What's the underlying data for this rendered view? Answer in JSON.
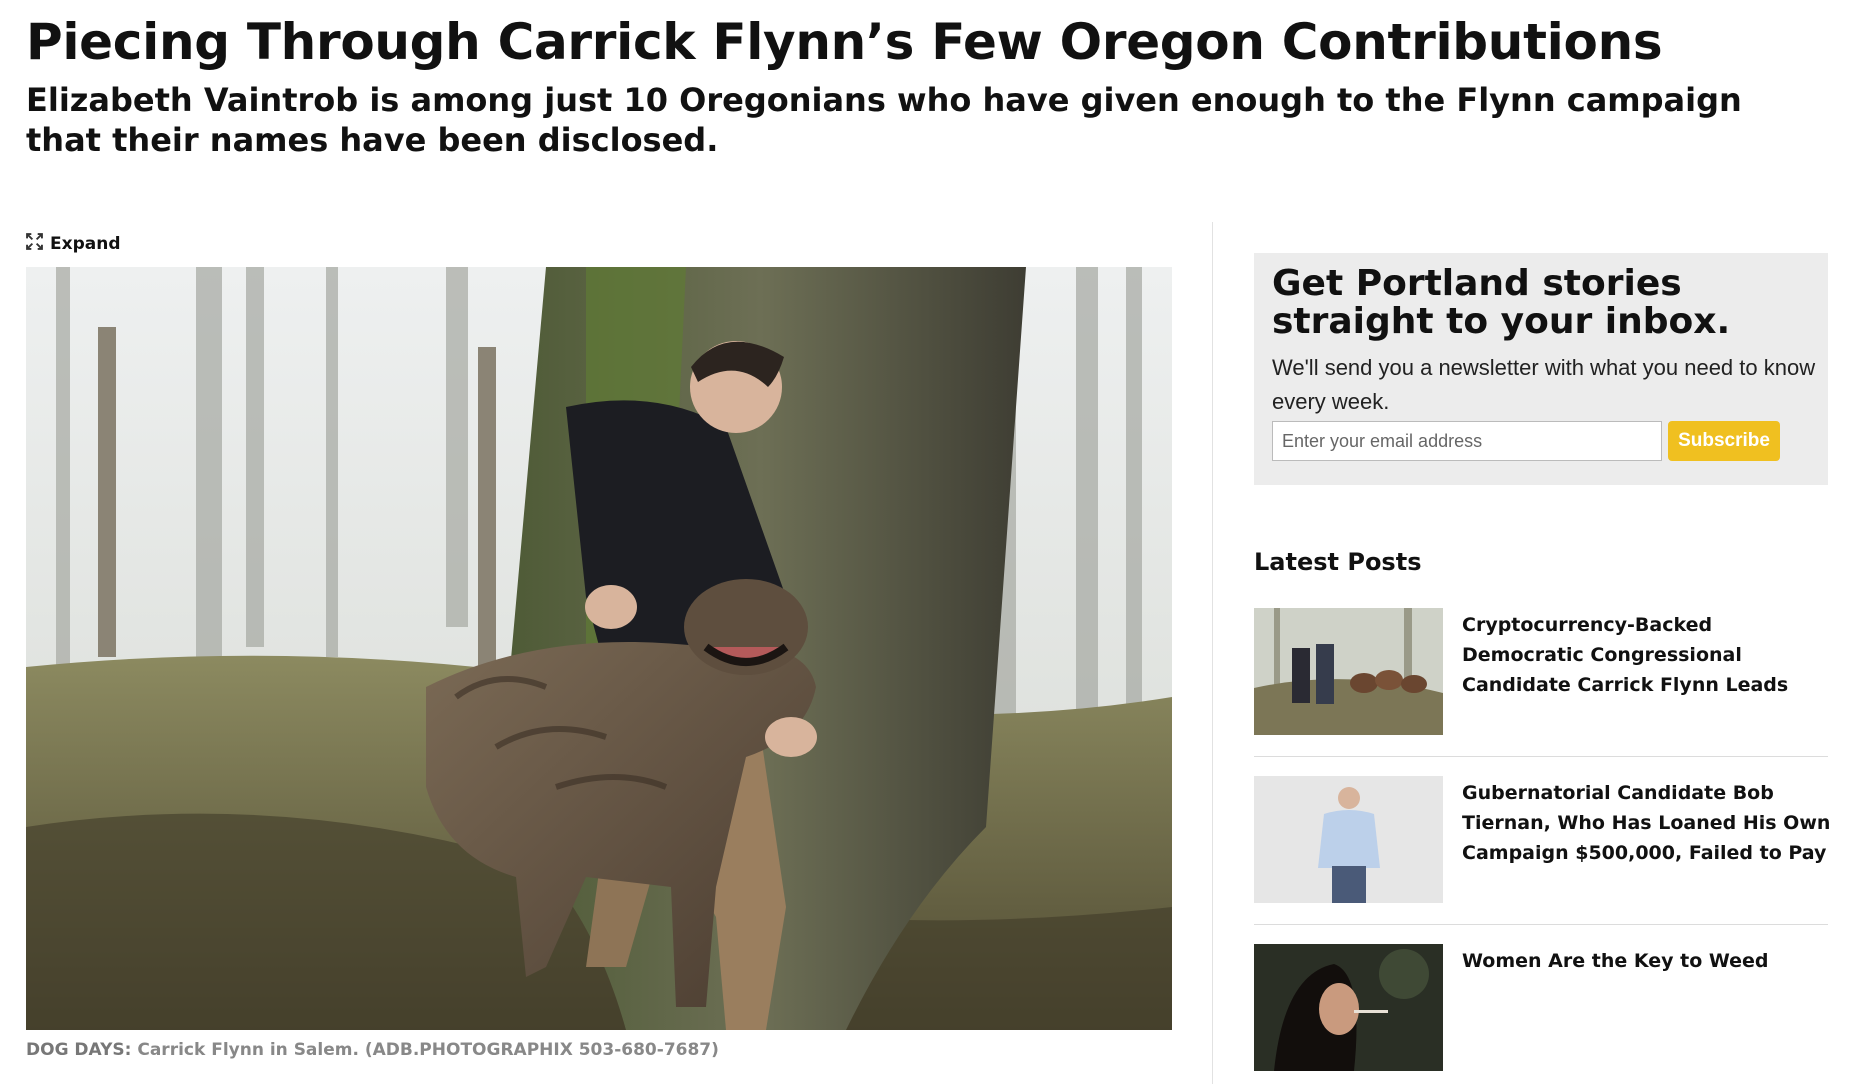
{
  "article": {
    "headline": "Piecing Through Carrick Flynn’s Few Oregon Contributions",
    "dek": "Elizabeth Vaintrob is among just 10 Oregonians who have given enough to the Flynn campaign that their names have been disclosed."
  },
  "media": {
    "expand_label": "Expand",
    "caption_lead": "DOG DAYS:",
    "caption_text": " Carrick Flynn in Salem. (ADB.PHOTOGRAPHIX 503-680-7687)"
  },
  "newsletter": {
    "title": "Get Portland stories straight to your inbox.",
    "text": "We'll send you a newsletter with what you need to know every week.",
    "email_placeholder": "Enter your email address",
    "subscribe_label": "Subscribe",
    "button_color": "#f0c020"
  },
  "latest_posts": {
    "heading": "Latest Posts",
    "items": [
      {
        "title": "Cryptocurrency-Backed Democratic Congressional Candidate Carrick Flynn Leads"
      },
      {
        "title": "Gubernatorial Candidate Bob Tiernan, Who Has Loaned His Own Campaign $500,000, Failed to Pay"
      },
      {
        "title": "Women Are the Key to Weed"
      }
    ]
  }
}
